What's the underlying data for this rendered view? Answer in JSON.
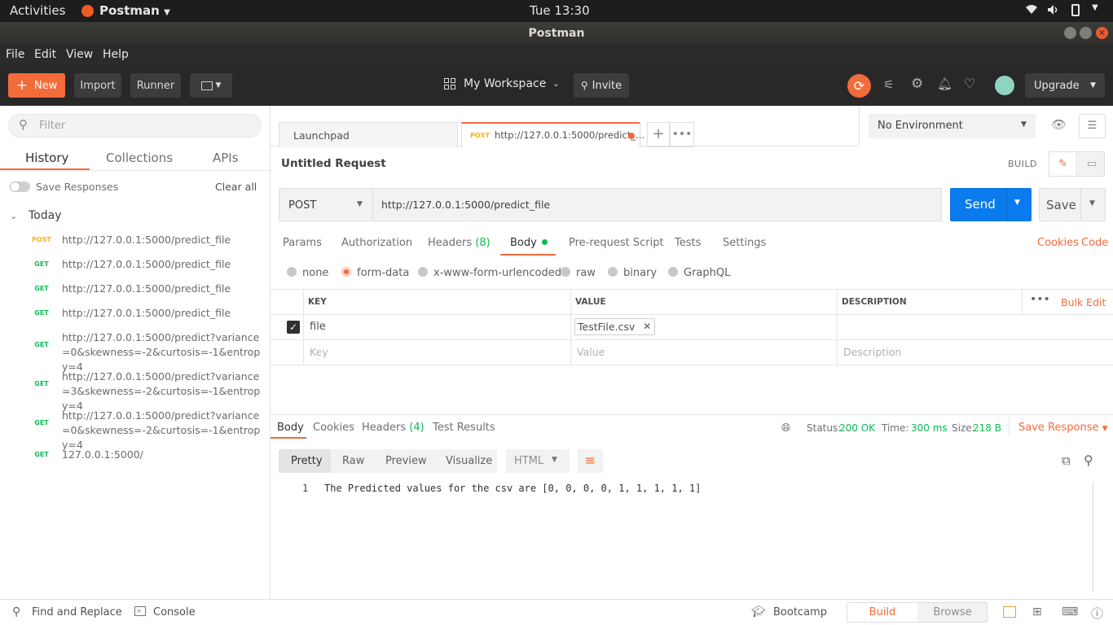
{
  "system": {
    "activities": "Activities",
    "app": "Postman",
    "clock": "Tue 13:30"
  },
  "window": {
    "title": "Postman"
  },
  "menu": [
    "File",
    "Edit",
    "View",
    "Help"
  ],
  "header": {
    "new": "New",
    "import": "Import",
    "runner": "Runner",
    "workspace": "My Workspace",
    "invite": "Invite",
    "upgrade": "Upgrade"
  },
  "sidebar": {
    "filter_placeholder": "Filter",
    "tabs": [
      "History",
      "Collections",
      "APIs"
    ],
    "save_responses": "Save Responses",
    "clear_all": "Clear all",
    "group": "Today",
    "items": [
      {
        "method": "POST",
        "url": "http://127.0.0.1:5000/predict_file"
      },
      {
        "method": "GET",
        "url": "http://127.0.0.1:5000/predict_file"
      },
      {
        "method": "GET",
        "url": "http://127.0.0.1:5000/predict_file"
      },
      {
        "method": "GET",
        "url": "http://127.0.0.1:5000/predict_file"
      },
      {
        "method": "GET",
        "url": "http://127.0.0.1:5000/predict?variance=0&skewness=-2&curtosis=-1&entropy=4"
      },
      {
        "method": "GET",
        "url": "http://127.0.0.1:5000/predict?variance=3&skewness=-2&curtosis=-1&entropy=4"
      },
      {
        "method": "GET",
        "url": "http://127.0.0.1:5000/predict?variance=0&skewness=-2&curtosis=-1&entropy=4"
      },
      {
        "method": "GET",
        "url": "127.0.0.1:5000/"
      }
    ]
  },
  "tabs": {
    "launchpad": "Launchpad",
    "active_method": "POST",
    "active_url": "http://127.0.0.1:5000/predict_...",
    "environment": "No Environment"
  },
  "request": {
    "title": "Untitled Request",
    "build": "BUILD",
    "method": "POST",
    "url": "http://127.0.0.1:5000/predict_file",
    "send": "Send",
    "save": "Save",
    "subtabs": [
      "Params",
      "Authorization",
      "Headers",
      "Body",
      "Pre-request Script",
      "Tests",
      "Settings"
    ],
    "headers_count": "(8)",
    "cookies": "Cookies",
    "code": "Code",
    "body_types": [
      "none",
      "form-data",
      "x-www-form-urlencoded",
      "raw",
      "binary",
      "GraphQL"
    ],
    "table_headers": [
      "KEY",
      "VALUE",
      "DESCRIPTION"
    ],
    "bulk_edit": "Bulk Edit",
    "row_key": "file",
    "row_value": "TestFile.csv",
    "ph_key": "Key",
    "ph_value": "Value",
    "ph_description": "Description"
  },
  "response": {
    "tabs": [
      "Body",
      "Cookies",
      "Headers",
      "Test Results"
    ],
    "headers_count": "(4)",
    "status_label": "Status:",
    "status": "200 OK",
    "time_label": "Time:",
    "time": "300 ms",
    "size_label": "Size:",
    "size": "218 B",
    "save_response": "Save Response",
    "views": [
      "Pretty",
      "Raw",
      "Preview",
      "Visualize"
    ],
    "format": "HTML",
    "line_number": "1",
    "body_text": "The Predicted values for the csv are [0, 0, 0, 0, 1, 1, 1, 1, 1]"
  },
  "footer": {
    "find_replace": "Find and Replace",
    "console": "Console",
    "bootcamp": "Bootcamp",
    "build": "Build",
    "browse": "Browse"
  },
  "colors": {
    "accent": "#f26b3a",
    "send": "#097bed",
    "get": "#0cbb52",
    "post": "#ffb400"
  }
}
